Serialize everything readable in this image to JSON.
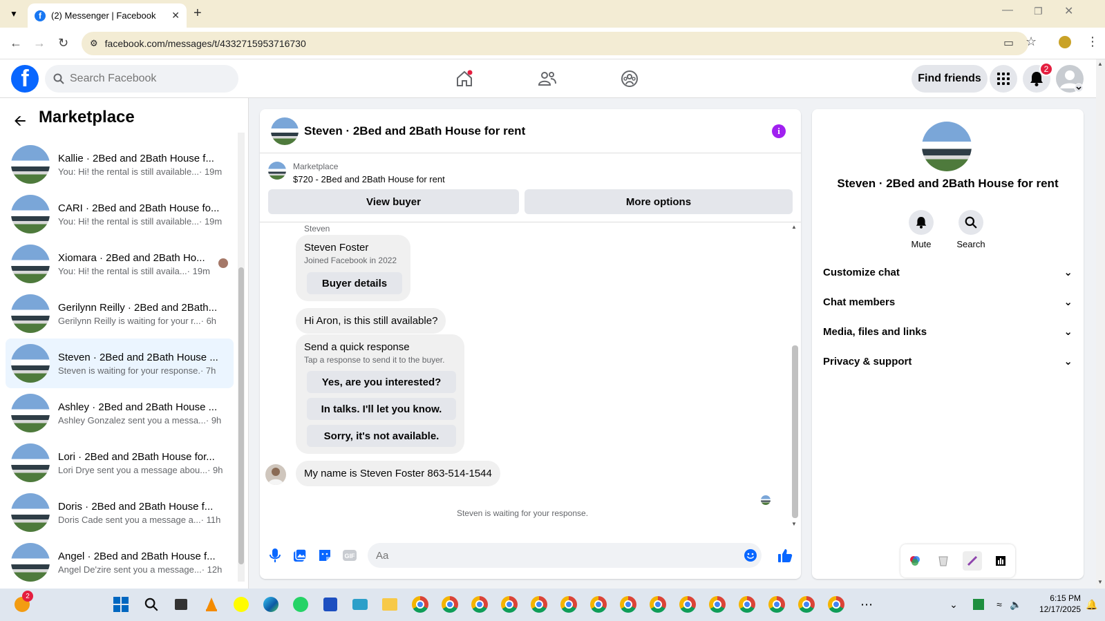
{
  "browser": {
    "tab_title": "(2) Messenger | Facebook",
    "url": "facebook.com/messages/t/4332715953716730"
  },
  "header": {
    "search_placeholder": "Search Facebook",
    "find_friends": "Find friends",
    "notification_count": "2"
  },
  "left_panel": {
    "title": "Marketplace",
    "conversations": [
      {
        "name": "Kallie · 2Bed and 2Bath House f...",
        "message": "You: Hi! the rental is still available...",
        "time": " · 19m"
      },
      {
        "name": "CARI · 2Bed and 2Bath House fo...",
        "message": "You: Hi! the rental is still available...",
        "time": " · 19m"
      },
      {
        "name": "Xiomara · 2Bed and 2Bath Ho...",
        "message": "You: Hi! the rental is still availa...",
        "time": " · 19m"
      },
      {
        "name": "Gerilynn Reilly · 2Bed and 2Bath...",
        "message": "Gerilynn Reilly is waiting for your r...",
        "time": " · 6h"
      },
      {
        "name": "Steven · 2Bed and 2Bath House ...",
        "message": "Steven is waiting for your response.",
        "time": " · 7h"
      },
      {
        "name": "Ashley · 2Bed and 2Bath House ...",
        "message": "Ashley Gonzalez sent you a messa...",
        "time": " · 9h"
      },
      {
        "name": "Lori · 2Bed and 2Bath House for...",
        "message": "Lori Drye sent you a message abou...",
        "time": " · 9h"
      },
      {
        "name": "Doris · 2Bed and 2Bath House f...",
        "message": "Doris Cade sent you a message a...",
        "time": " · 11h"
      },
      {
        "name": "Angel · 2Bed and 2Bath House f...",
        "message": "Angel De'zire sent you a message...",
        "time": " · 12h"
      }
    ]
  },
  "chat": {
    "title": "Steven · 2Bed and 2Bath House for rent",
    "marketplace_label": "Marketplace",
    "listing": "$720 - 2Bed and 2Bath House for rent",
    "view_buyer": "View buyer",
    "more_options": "More options",
    "sender_label": "Steven",
    "profile_card": {
      "name": "Steven Foster",
      "joined": "Joined Facebook in 2022",
      "button": "Buyer details"
    },
    "message1": "Hi Aron, is this still available?",
    "quick_response": {
      "title": "Send a quick response",
      "subtitle": "Tap a response to send it to the buyer.",
      "options": [
        "Yes, are you interested?",
        "In talks. I'll let you know.",
        "Sorry, it's not available."
      ]
    },
    "message2": "My name is Steven Foster 863-514-1544",
    "waiting": "Steven is waiting for your response.",
    "input_placeholder": "Aa"
  },
  "right_panel": {
    "name": "Steven · 2Bed and 2Bath House for rent",
    "mute": "Mute",
    "search": "Search",
    "rows": [
      "Customize chat",
      "Chat members",
      "Media, files and links",
      "Privacy & support"
    ]
  },
  "taskbar": {
    "time": "6:15 PM",
    "date": "12/17/2025",
    "weather_badge": "2"
  }
}
